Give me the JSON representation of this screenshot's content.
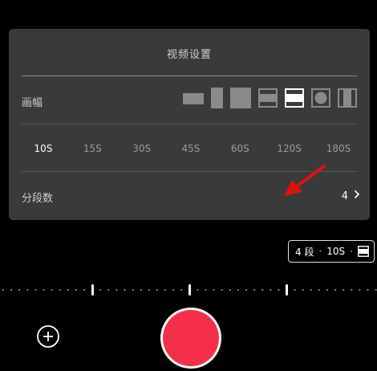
{
  "panel": {
    "title": "视频设置",
    "frame_label": "画幅",
    "aspect_options": [
      {
        "icon": "aspect-16-9-icon",
        "selected": false
      },
      {
        "icon": "aspect-9-16-icon",
        "selected": false
      },
      {
        "icon": "aspect-1-1-icon",
        "selected": false
      },
      {
        "icon": "aspect-letterbox-icon",
        "selected": false
      },
      {
        "icon": "aspect-letterbox-selected-icon",
        "selected": true
      },
      {
        "icon": "aspect-circle-icon",
        "selected": false
      },
      {
        "icon": "aspect-pillarbox-icon",
        "selected": false
      }
    ],
    "durations": [
      {
        "label": "10S",
        "active": true
      },
      {
        "label": "15S",
        "active": false
      },
      {
        "label": "30S",
        "active": false
      },
      {
        "label": "45S",
        "active": false
      },
      {
        "label": "60S",
        "active": false
      },
      {
        "label": "120S",
        "active": false
      },
      {
        "label": "180S",
        "active": false
      }
    ],
    "segments_label": "分段数",
    "segments_value": "4"
  },
  "status": {
    "segments": "4 段",
    "duration": "10S",
    "aspect_icon": "aspect-letterbox-icon"
  },
  "colors": {
    "panel_bg": "#3a3a3a",
    "record": "#f52f4a",
    "annotation_arrow": "#e01010"
  },
  "icons": {
    "add": "plus-circle-icon",
    "chevron": "chevron-right-icon",
    "annotation": "red-arrow-annotation"
  }
}
